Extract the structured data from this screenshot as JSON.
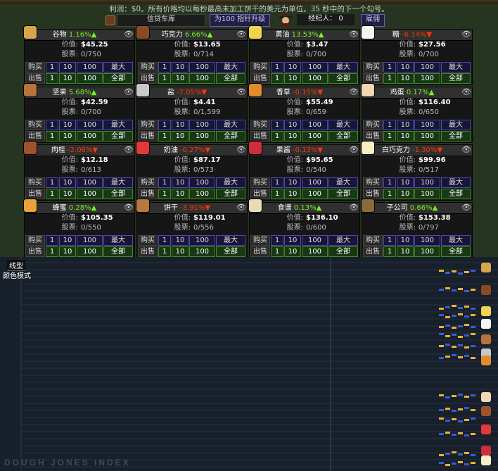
{
  "header": {
    "profit_text": "利润：$0。所有价格均以每秒最高未加工饼干的美元为单位。35 秒中的下一个勾号。",
    "bank_name": "信贷车库",
    "upgrade_label": "为100 指针升级",
    "brokers_label": "经纪人：",
    "brokers_count": "0",
    "hire_label": "雇佣"
  },
  "labels": {
    "price": "价值:",
    "shares": "股票:",
    "buy": "购买",
    "sell": "出售",
    "q1": "1",
    "q10": "10",
    "q100": "100",
    "max": "最大",
    "all": "全部"
  },
  "goods": [
    {
      "name": "谷物",
      "delta": "1.16%▲",
      "dir": "up",
      "price": "$45.25",
      "shares": "0/750",
      "icon_color": "#d7a64a"
    },
    {
      "name": "巧克力",
      "delta": "6.66%▲",
      "dir": "up",
      "price": "$13.65",
      "shares": "0/714",
      "icon_color": "#8a4b24"
    },
    {
      "name": "黄油",
      "delta": "13.53%▲",
      "dir": "up",
      "price": "$3.47",
      "shares": "0/700",
      "icon_color": "#f2d34f"
    },
    {
      "name": "糖",
      "delta": "-6.14%▼",
      "dir": "down",
      "price": "$27.56",
      "shares": "0/700",
      "icon_color": "#f4f4f4"
    },
    {
      "name": "坚果",
      "delta": "5.68%▲",
      "dir": "up",
      "price": "$42.59",
      "shares": "0/700",
      "icon_color": "#b8733a"
    },
    {
      "name": "盐",
      "delta": "-7.05%▼",
      "dir": "down",
      "price": "$4.41",
      "shares": "0/1,599",
      "icon_color": "#c9c9c9"
    },
    {
      "name": "香草",
      "delta": "-0.15%▼",
      "dir": "down",
      "price": "$55.49",
      "shares": "0/659",
      "icon_color": "#e08c2c"
    },
    {
      "name": "鸡蛋",
      "delta": "0.17%▲",
      "dir": "up",
      "price": "$116.40",
      "shares": "0/650",
      "icon_color": "#f2d7b0"
    },
    {
      "name": "肉桂",
      "delta": "-2.06%▼",
      "dir": "down",
      "price": "$12.18",
      "shares": "0/613",
      "icon_color": "#a0522d"
    },
    {
      "name": "奶油",
      "delta": "-0.27%▼",
      "dir": "down",
      "price": "$87.17",
      "shares": "0/573",
      "icon_color": "#e23a3a"
    },
    {
      "name": "果酱",
      "delta": "-0.13%▼",
      "dir": "down",
      "price": "$95.65",
      "shares": "0/540",
      "icon_color": "#cc2e3c"
    },
    {
      "name": "白巧克力",
      "delta": "-1.30%▼",
      "dir": "down",
      "price": "$99.96",
      "shares": "0/517",
      "icon_color": "#f7efc4"
    },
    {
      "name": "蜂蜜",
      "delta": "0.28%▲",
      "dir": "up",
      "price": "$105.35",
      "shares": "0/550",
      "icon_color": "#e8a23a"
    },
    {
      "name": "饼干",
      "delta": "-3.91%▼",
      "dir": "down",
      "price": "$119.01",
      "shares": "0/556",
      "icon_color": "#b87a3c"
    },
    {
      "name": "食谱",
      "delta": "0.13%▲",
      "dir": "up",
      "price": "$136.10",
      "shares": "0/600",
      "icon_color": "#e8dcb8"
    },
    {
      "name": "子公司",
      "delta": "0.66%▲",
      "dir": "up",
      "price": "$153.38",
      "shares": "0/797",
      "icon_color": "#8a6a3a"
    }
  ],
  "graph": {
    "mode_line": "线型",
    "mode_color": "颜色模式",
    "watermark": "DOUGH JONES INDEX"
  },
  "colors": {
    "up": "#73f21f",
    "down": "#ff3305",
    "buy_button": "#161638",
    "sell_button": "#173812",
    "graph_bg": "#18202b"
  }
}
